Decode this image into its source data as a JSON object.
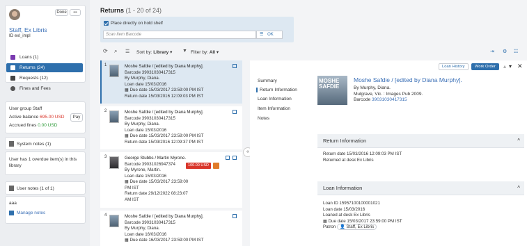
{
  "user": {
    "done_label": "Done",
    "more_label": "•••",
    "name": "Staff, Ex Libris",
    "id_line": "ID exl_impl"
  },
  "nav": [
    {
      "label": "Loans (1)",
      "icon": "loans-icon"
    },
    {
      "label": "Returns (24)",
      "icon": "returns-icon"
    },
    {
      "label": "Requests (12)",
      "icon": "requests-icon"
    },
    {
      "label": "Fines and Fees",
      "icon": "fines-icon"
    }
  ],
  "account": {
    "group_line": "User group Staff",
    "balance_label": "Active balance",
    "balance_value": "695.00 USD",
    "fines_label": "Accrued fines",
    "fines_value": "0.00 USD",
    "pay_label": "Pay"
  },
  "system_notes": {
    "title": "System notes (1)",
    "text": "User has 1 overdue item(s) in this library"
  },
  "user_notes": {
    "title": "User notes (1 of 1)",
    "text": "aaa",
    "manage_label": "Manage notes"
  },
  "main": {
    "title": "Returns",
    "count": "(1 - 20 of 24)",
    "hold_shelf_label": "Place directly on hold shelf",
    "scan_placeholder": "Scan Item Barcode",
    "ok_label": "OK",
    "sort_label": "Sort by:",
    "sort_value": "Library",
    "filter_label": "Filter by:",
    "filter_value": "All"
  },
  "rows": [
    {
      "num": "1",
      "title": "Moshe Safdie / [edited by Diana Murphy].",
      "barcode": "Barcode 39031030417315",
      "by": "By Murphy, Diana.",
      "loan": "Loan date 15/03/2016",
      "due": "Due date 15/03/2017 23:59:00 PM IST",
      "ret": "Return date 15/03/2016 12:09:03 PM IST"
    },
    {
      "num": "2",
      "title": "Moshe Safdie / [edited by Diana Murphy].",
      "barcode": "Barcode 39031030417315",
      "by": "By Murphy, Diana.",
      "loan": "Loan date 15/03/2016",
      "due": "Due date 15/03/2017 23:59:00 PM IST",
      "ret": "Return date 15/03/2016 12:09:37 PM IST"
    },
    {
      "num": "3",
      "title": "George Stubbs / Martin Myrone.",
      "barcode": "Barcode 39031026947374",
      "by": "By Myrone, Martin.",
      "loan": "Loan date 15/03/2016",
      "due": "Due date 15/03/2017 23:59:00",
      "due2": "PM IST",
      "ret": "Return date 29/12/2022 08:23:07",
      "ret2": "AM IST",
      "fee": "100.00 USD"
    },
    {
      "num": "4",
      "title": "Moshe Safdie / [edited by Diana Murphy].",
      "barcode": "Barcode 39031030417315",
      "by": "By Murphy, Diana.",
      "loan": "Loan date 16/03/2016",
      "due": "Due date 16/03/2017 23:59:00 PM IST"
    }
  ],
  "detail": {
    "tabs": [
      "Summary",
      "Return Information",
      "Loan Information",
      "Item Information",
      "Notes"
    ],
    "loan_history_label": "Loan History",
    "work_order_label": "Work Order",
    "cover_text": "MOSHE SAFDIE",
    "title": "Moshe Safdie / [edited by Diana Murphy].",
    "by": "By Murphy, Diana.",
    "pub": "Mulgrave, Vic. : Images Pub 2009.",
    "barcode_label": "Barcode",
    "barcode_value": "39031030417315",
    "return_section": {
      "title": "Return Information",
      "line1": "Return date 15/03/2016 12:09:03 PM IST",
      "line2": "Returned at desk Ex Libris"
    },
    "loan_section": {
      "title": "Loan Information",
      "loan_id": "Loan ID 15957100100001021",
      "loan_date": "Loan date 15/03/2016",
      "desk": "Loaned at desk Ex Libris",
      "due": "Due date 15/03/2017 23:59:00 PM IST",
      "patron_label": "Patron",
      "patron_value": "Staff, Ex Libris"
    }
  },
  "colors": {
    "primary": "#2e6fac",
    "balance": "#d9362b",
    "fines": "#2e9b3a"
  }
}
